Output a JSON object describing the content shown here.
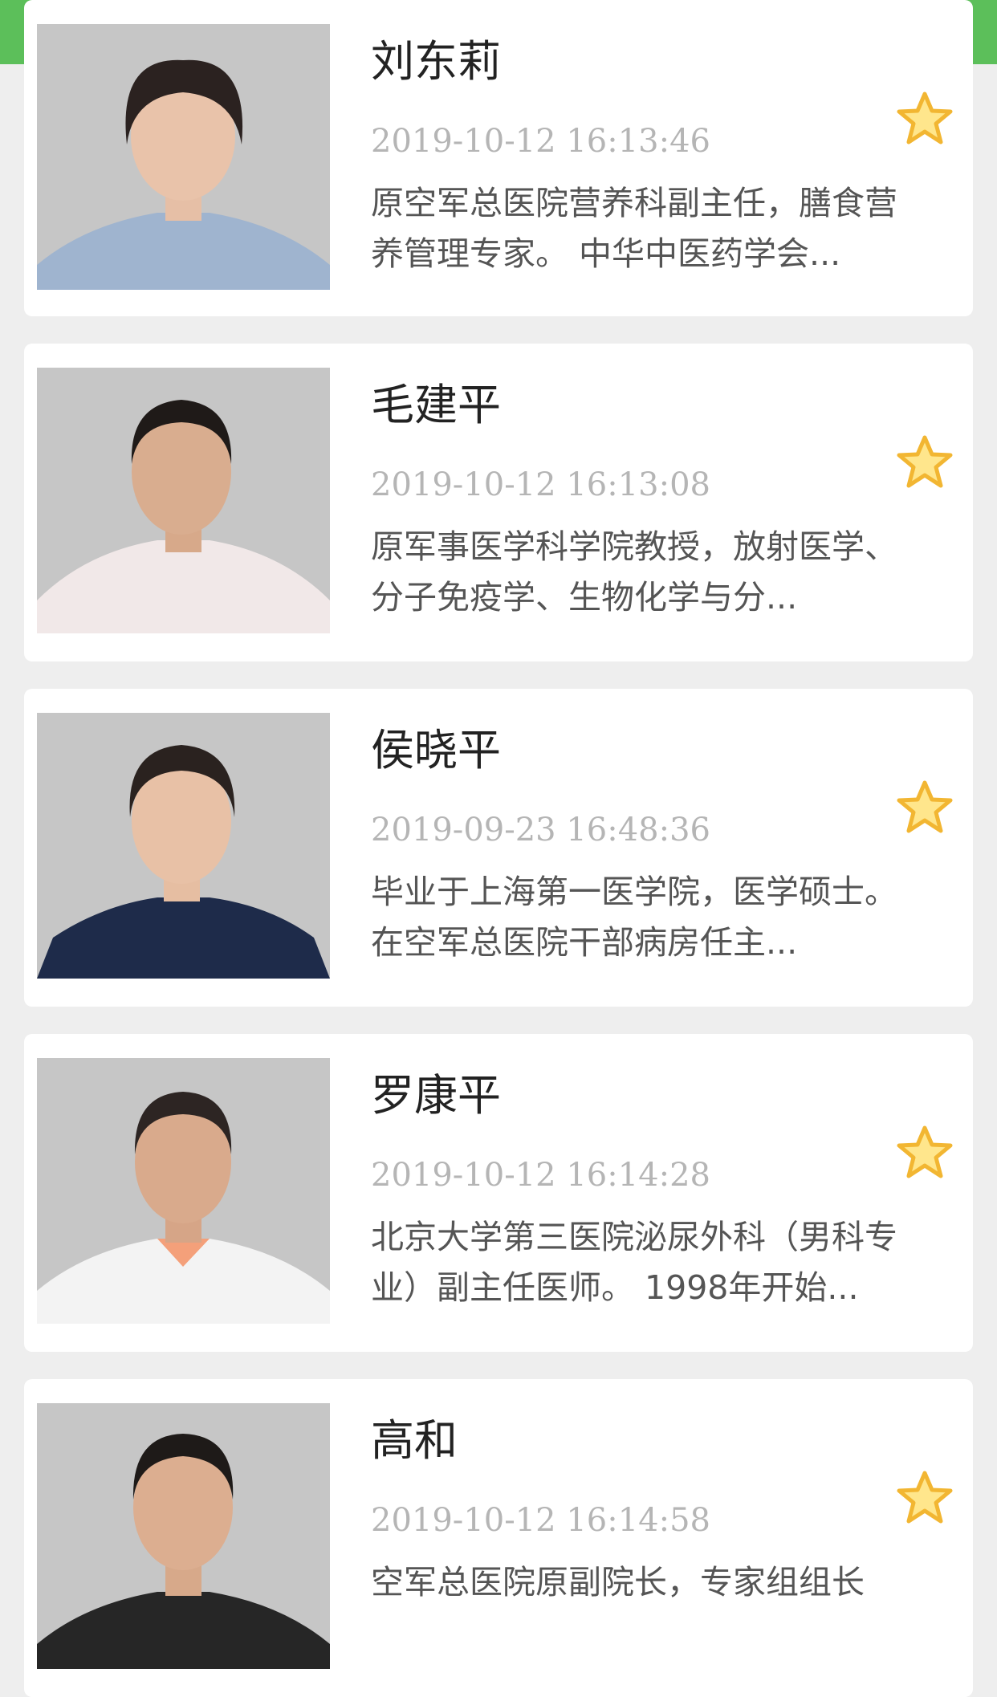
{
  "theme": {
    "accent": "#5cbf5a",
    "star_fill": "#ffe68c",
    "star_stroke": "#f2b632",
    "photo_bg": "#c4c4c4"
  },
  "doctors": [
    {
      "name": "刘东莉",
      "time": "2019-10-12 16:13:46",
      "desc": "原空军总医院营养科副主任，膳食营养管理专家。 中华中医药学会...",
      "icon": "star-outline-icon"
    },
    {
      "name": "毛建平",
      "time": "2019-10-12 16:13:08",
      "desc": "原军事医学科学院教授，放射医学、分子免疫学、生物化学与分...",
      "icon": "star-outline-icon"
    },
    {
      "name": "侯晓平",
      "time": "2019-09-23 16:48:36",
      "desc": "毕业于上海第一医学院，医学硕士。在空军总医院干部病房任主...",
      "icon": "star-outline-icon"
    },
    {
      "name": "罗康平",
      "time": "2019-10-12 16:14:28",
      "desc": "北京大学第三医院泌尿外科（男科专业）副主任医师。 1998年开始...",
      "icon": "star-outline-icon"
    },
    {
      "name": "高和",
      "time": "2019-10-12 16:14:58",
      "desc": "空军总医院原副院长，专家组组长",
      "icon": "star-outline-icon"
    }
  ]
}
